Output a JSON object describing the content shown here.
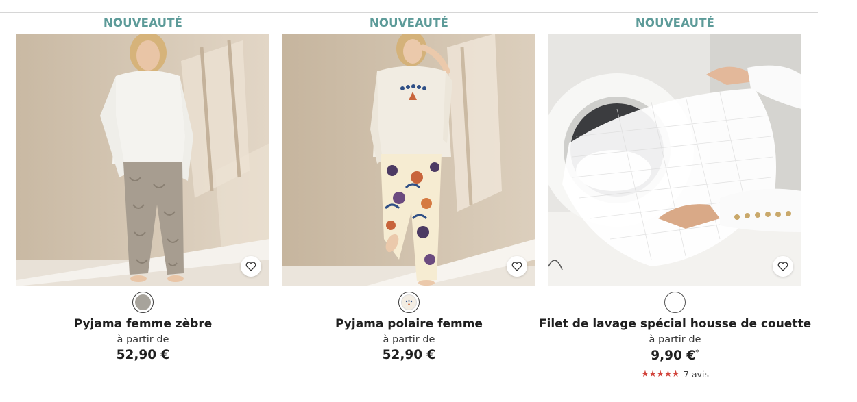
{
  "products": [
    {
      "badge": "NOUVEAUTÉ",
      "title": "Pyjama femme zèbre",
      "from_label": "à partir de",
      "price": "52,90 €",
      "price_note": "",
      "swatch_color": "#a7a39b",
      "image_icon": "pyjama-zebra-photo"
    },
    {
      "badge": "NOUVEAUTÉ",
      "title": "Pyjama polaire femme",
      "from_label": "à partir de",
      "price": "52,90 €",
      "price_note": "",
      "swatch_color": "#f3ede3",
      "image_icon": "pyjama-fleece-photo"
    },
    {
      "badge": "NOUVEAUTÉ",
      "title": "Filet de lavage spécial housse de couette",
      "from_label": "à partir de",
      "price": "9,90 €",
      "price_note": "*",
      "swatch_color": "#ffffff",
      "image_icon": "laundry-net-photo",
      "rating": {
        "stars": "★★★★★",
        "count_label": "7 avis",
        "value": 5
      }
    }
  ],
  "colors": {
    "badge": "#5d9b99",
    "stars": "#d2443c",
    "text": "#1f1f1f"
  },
  "icons": {
    "wishlist": "heart-outline-icon"
  }
}
